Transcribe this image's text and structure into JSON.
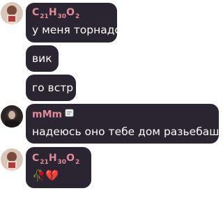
{
  "messages": [
    {
      "sender": {
        "c": "C",
        "c_sub": "2",
        "h_sub": "1",
        "h": "H",
        "o_pre_sub": "3",
        "o_sub": "0",
        "o": "O",
        "tail_sub": "2"
      },
      "text": "у меня торнадо"
    },
    {
      "text": "вик"
    },
    {
      "text": "го встр"
    },
    {
      "sender_name": "mMm",
      "badge_icon": "paper-sticker-icon",
      "text": "надеюсь оно тебе дом разьебашит"
    },
    {
      "sender": {
        "c": "C",
        "c_sub": "2",
        "h_sub": "1",
        "h": "H",
        "o_pre_sub": "3",
        "o_sub": "0",
        "o": "O",
        "tail_sub": "2"
      },
      "emoji": "🥀💔"
    }
  ],
  "colors": {
    "bubble": "#2a2530",
    "sender_name": "#e38b9a",
    "text": "#ffffff",
    "background": "#ffffff"
  }
}
